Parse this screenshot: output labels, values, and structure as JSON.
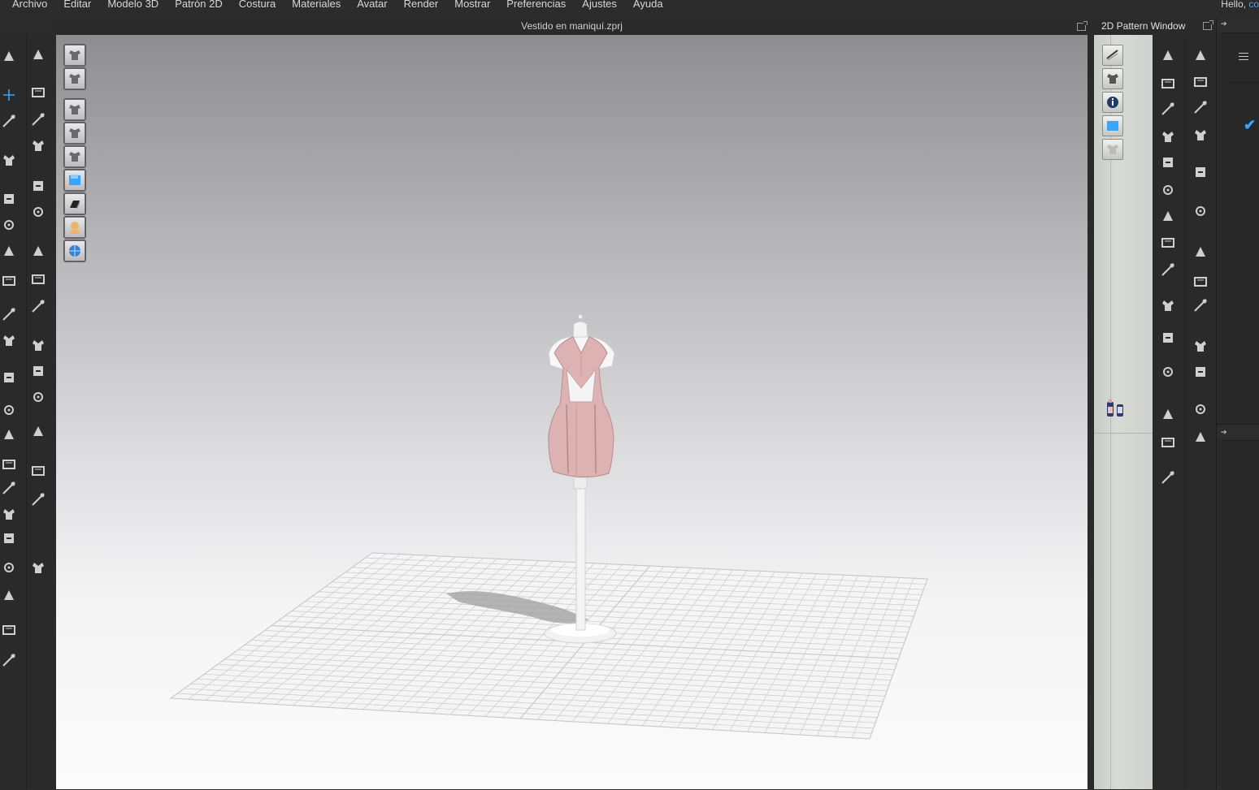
{
  "menu": {
    "items": [
      "Archivo",
      "Editar",
      "Modelo 3D",
      "Patrón 2D",
      "Costura",
      "Materiales",
      "Avatar",
      "Render",
      "Mostrar",
      "Preferencias",
      "Ajustes",
      "Ayuda"
    ],
    "greeting": "Hello,",
    "user": "co"
  },
  "viewport_3d": {
    "title": "Vestido en maniquí.zprj",
    "toolbar_icons": [
      "shaded-view-icon",
      "garment-view-icon",
      "show-garment-icon",
      "show-pattern-icon",
      "show-avatar-icon",
      "texture-view-icon",
      "thickness-icon",
      "avatar-skin-icon",
      "environment-icon"
    ]
  },
  "pattern_window": {
    "title": "2D Pattern Window",
    "toolbar_icons": [
      "show-mesh-icon",
      "show-garment-icon",
      "info-icon",
      "texture-icon",
      "lock-garment-icon"
    ]
  },
  "tools_left_col1": [
    "select-move-icon",
    "transform-pattern-icon",
    "edit-pattern-icon",
    "fold-icon",
    "tack-icon",
    "seam-icon",
    "segment-sewing-icon",
    "free-sewing-icon",
    "arrange-point-icon",
    "pin-icon",
    "pleat-icon",
    "measure-icon",
    "avatar-measure-icon",
    "fitting-suit-icon",
    "hang-icon",
    "pose-icon",
    "mannequin-icon",
    "tape-icon",
    "pencil-icon",
    "shirt-icon",
    "garment-icon"
  ],
  "tools_left_col2": [
    "walk-icon",
    "brush-icon",
    "texture-brush-icon",
    "edit-texture-icon",
    "puckering-icon",
    "edit-sewing-icon",
    "graphic-icon",
    "graphic-edit-icon",
    "button-icon",
    "buttonhole-icon",
    "zipper-icon",
    "lock-icon",
    "layer-icon",
    "layer-clone-icon",
    "fold-arrange-icon",
    "arrow-icon"
  ],
  "tools_right_col1": [
    "polygon-icon",
    "rectangle-icon",
    "internal-polygon-icon",
    "internal-rectangle-icon",
    "dart-icon",
    "trace-icon",
    "notch-icon",
    "offset-icon",
    "curve-point-icon",
    "ruler-icon",
    "annotation-icon",
    "text-icon",
    "grid-icon",
    "fabric-icon",
    "avatar-tool-icon"
  ],
  "tools_right_col2": [
    "edit-curve-icon",
    "segment-icon",
    "free-seam-icon",
    "sewing-check-icon",
    "fold-line-icon",
    "hem-icon",
    "trim-icon",
    "button-2d-icon",
    "zipper-2d-icon",
    "elastic-icon",
    "measure-2d-icon",
    "baseline-icon",
    "pattern-grid-icon"
  ],
  "accent_color": "#3aa5ff",
  "garment_color": "#dcb2b2"
}
